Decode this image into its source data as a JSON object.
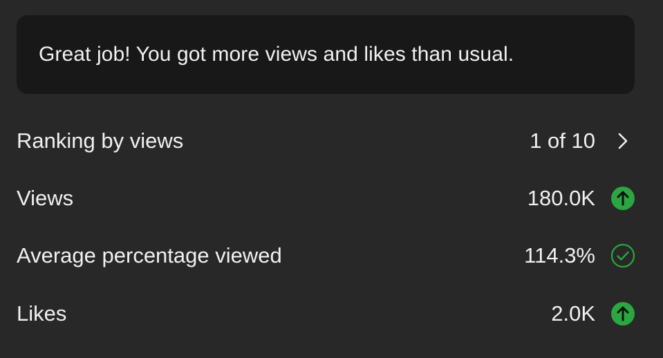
{
  "banner": {
    "message": "Great job! You got more views and likes than usual."
  },
  "stats": [
    {
      "label": "Ranking by views",
      "value": "1 of 10",
      "icon": "chevron-right-icon"
    },
    {
      "label": "Views",
      "value": "180.0K",
      "icon": "arrow-up-circle-icon",
      "status_color": "#2ba640"
    },
    {
      "label": "Average percentage viewed",
      "value": "114.3%",
      "icon": "check-circle-outline-icon",
      "status_color": "#2ba640"
    },
    {
      "label": "Likes",
      "value": "2.0K",
      "icon": "arrow-up-circle-icon",
      "status_color": "#2ba640"
    }
  ],
  "colors": {
    "background": "#282828",
    "banner_background": "#181818",
    "text": "#f1f1f1",
    "positive": "#2ba640"
  }
}
